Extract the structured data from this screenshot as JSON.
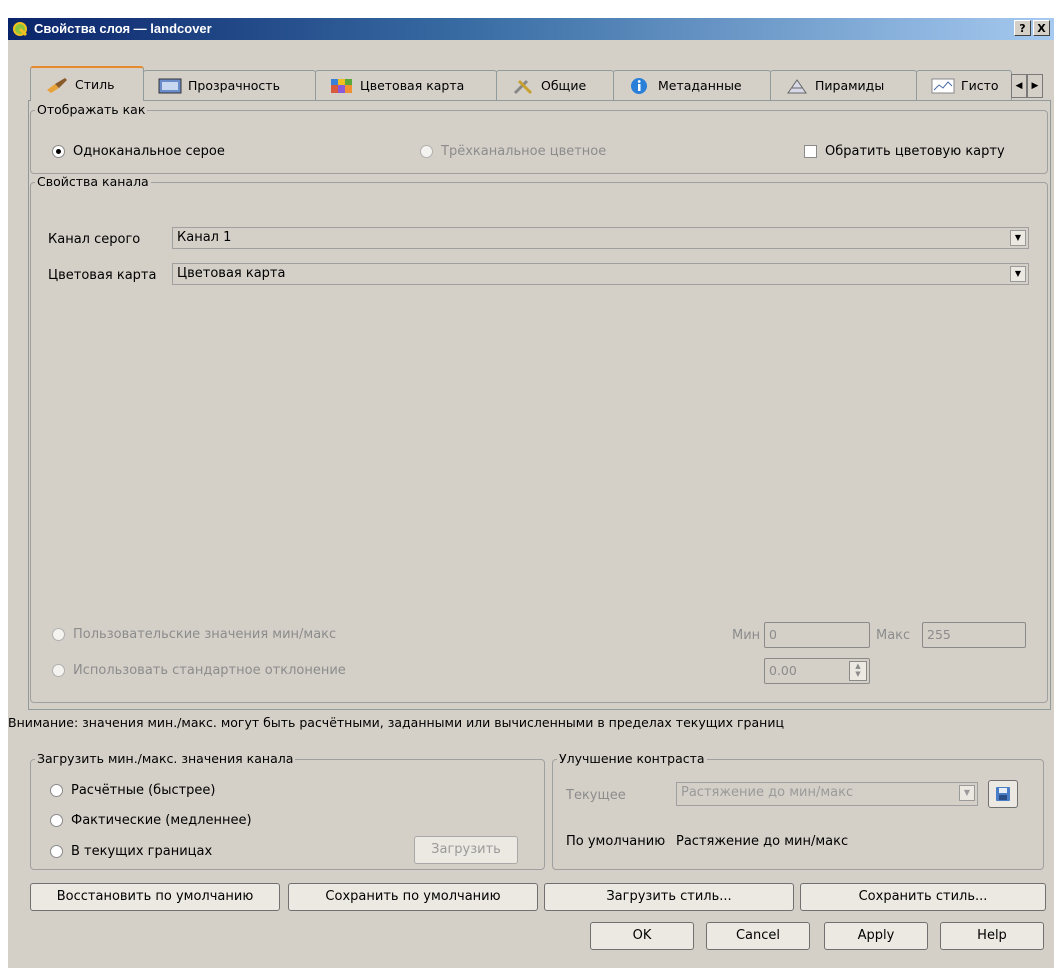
{
  "window": {
    "title": "Свойства слоя — landcover",
    "help_btn": "?",
    "close_btn": "X"
  },
  "tabs": [
    {
      "label": "Стиль",
      "icon": "brush-icon"
    },
    {
      "label": "Прозрачность",
      "icon": "transparency-icon"
    },
    {
      "label": "Цветовая карта",
      "icon": "colormap-icon"
    },
    {
      "label": "Общие",
      "icon": "tools-icon"
    },
    {
      "label": "Метаданные",
      "icon": "info-icon"
    },
    {
      "label": "Пирамиды",
      "icon": "pyramid-icon"
    },
    {
      "label": "Гисто",
      "icon": "histogram-icon"
    }
  ],
  "display_as": {
    "title": "Отображать как",
    "single_band": "Одноканальное серое",
    "three_band": "Трёхканальное цветное",
    "invert": "Обратить цветовую карту"
  },
  "band_props": {
    "title": "Свойства канала",
    "gray_band_label": "Канал серого",
    "gray_band_value": "Канал 1",
    "colormap_label": "Цветовая карта",
    "colormap_value": "Цветовая карта",
    "custom_minmax": "Пользовательские значения мин/макс",
    "use_stddev": "Использовать стандартное отклонение",
    "min_label": "Мин",
    "min_value": "0",
    "max_label": "Макс",
    "max_value": "255",
    "stddev_value": "0.00"
  },
  "warning": "Внимание: значения мин./макс. могут быть расчётными, заданными или вычисленными в пределах текущих границ",
  "load_minmax": {
    "title": "Загрузить мин./макс. значения канала",
    "estimate": "Расчётные (быстрее)",
    "actual": "Фактические (медленнее)",
    "extent": "В текущих границах",
    "load_btn": "Загрузить"
  },
  "contrast": {
    "title": "Улучшение контраста",
    "current_label": "Текущее",
    "current_value": "Растяжение до мин/макс",
    "default_label": "По умолчанию",
    "default_value": "Растяжение до мин/макс"
  },
  "style_buttons": {
    "restore": "Восстановить по умолчанию",
    "save_default": "Сохранить по умолчанию",
    "load_style": "Загрузить стиль...",
    "save_style": "Сохранить стиль..."
  },
  "dialog_buttons": {
    "ok": "OK",
    "cancel": "Cancel",
    "apply": "Apply",
    "help": "Help"
  },
  "colors": {
    "accent_tab": "#e68b2c",
    "title_start": "#0a246a",
    "face": "#d4d0c8"
  }
}
